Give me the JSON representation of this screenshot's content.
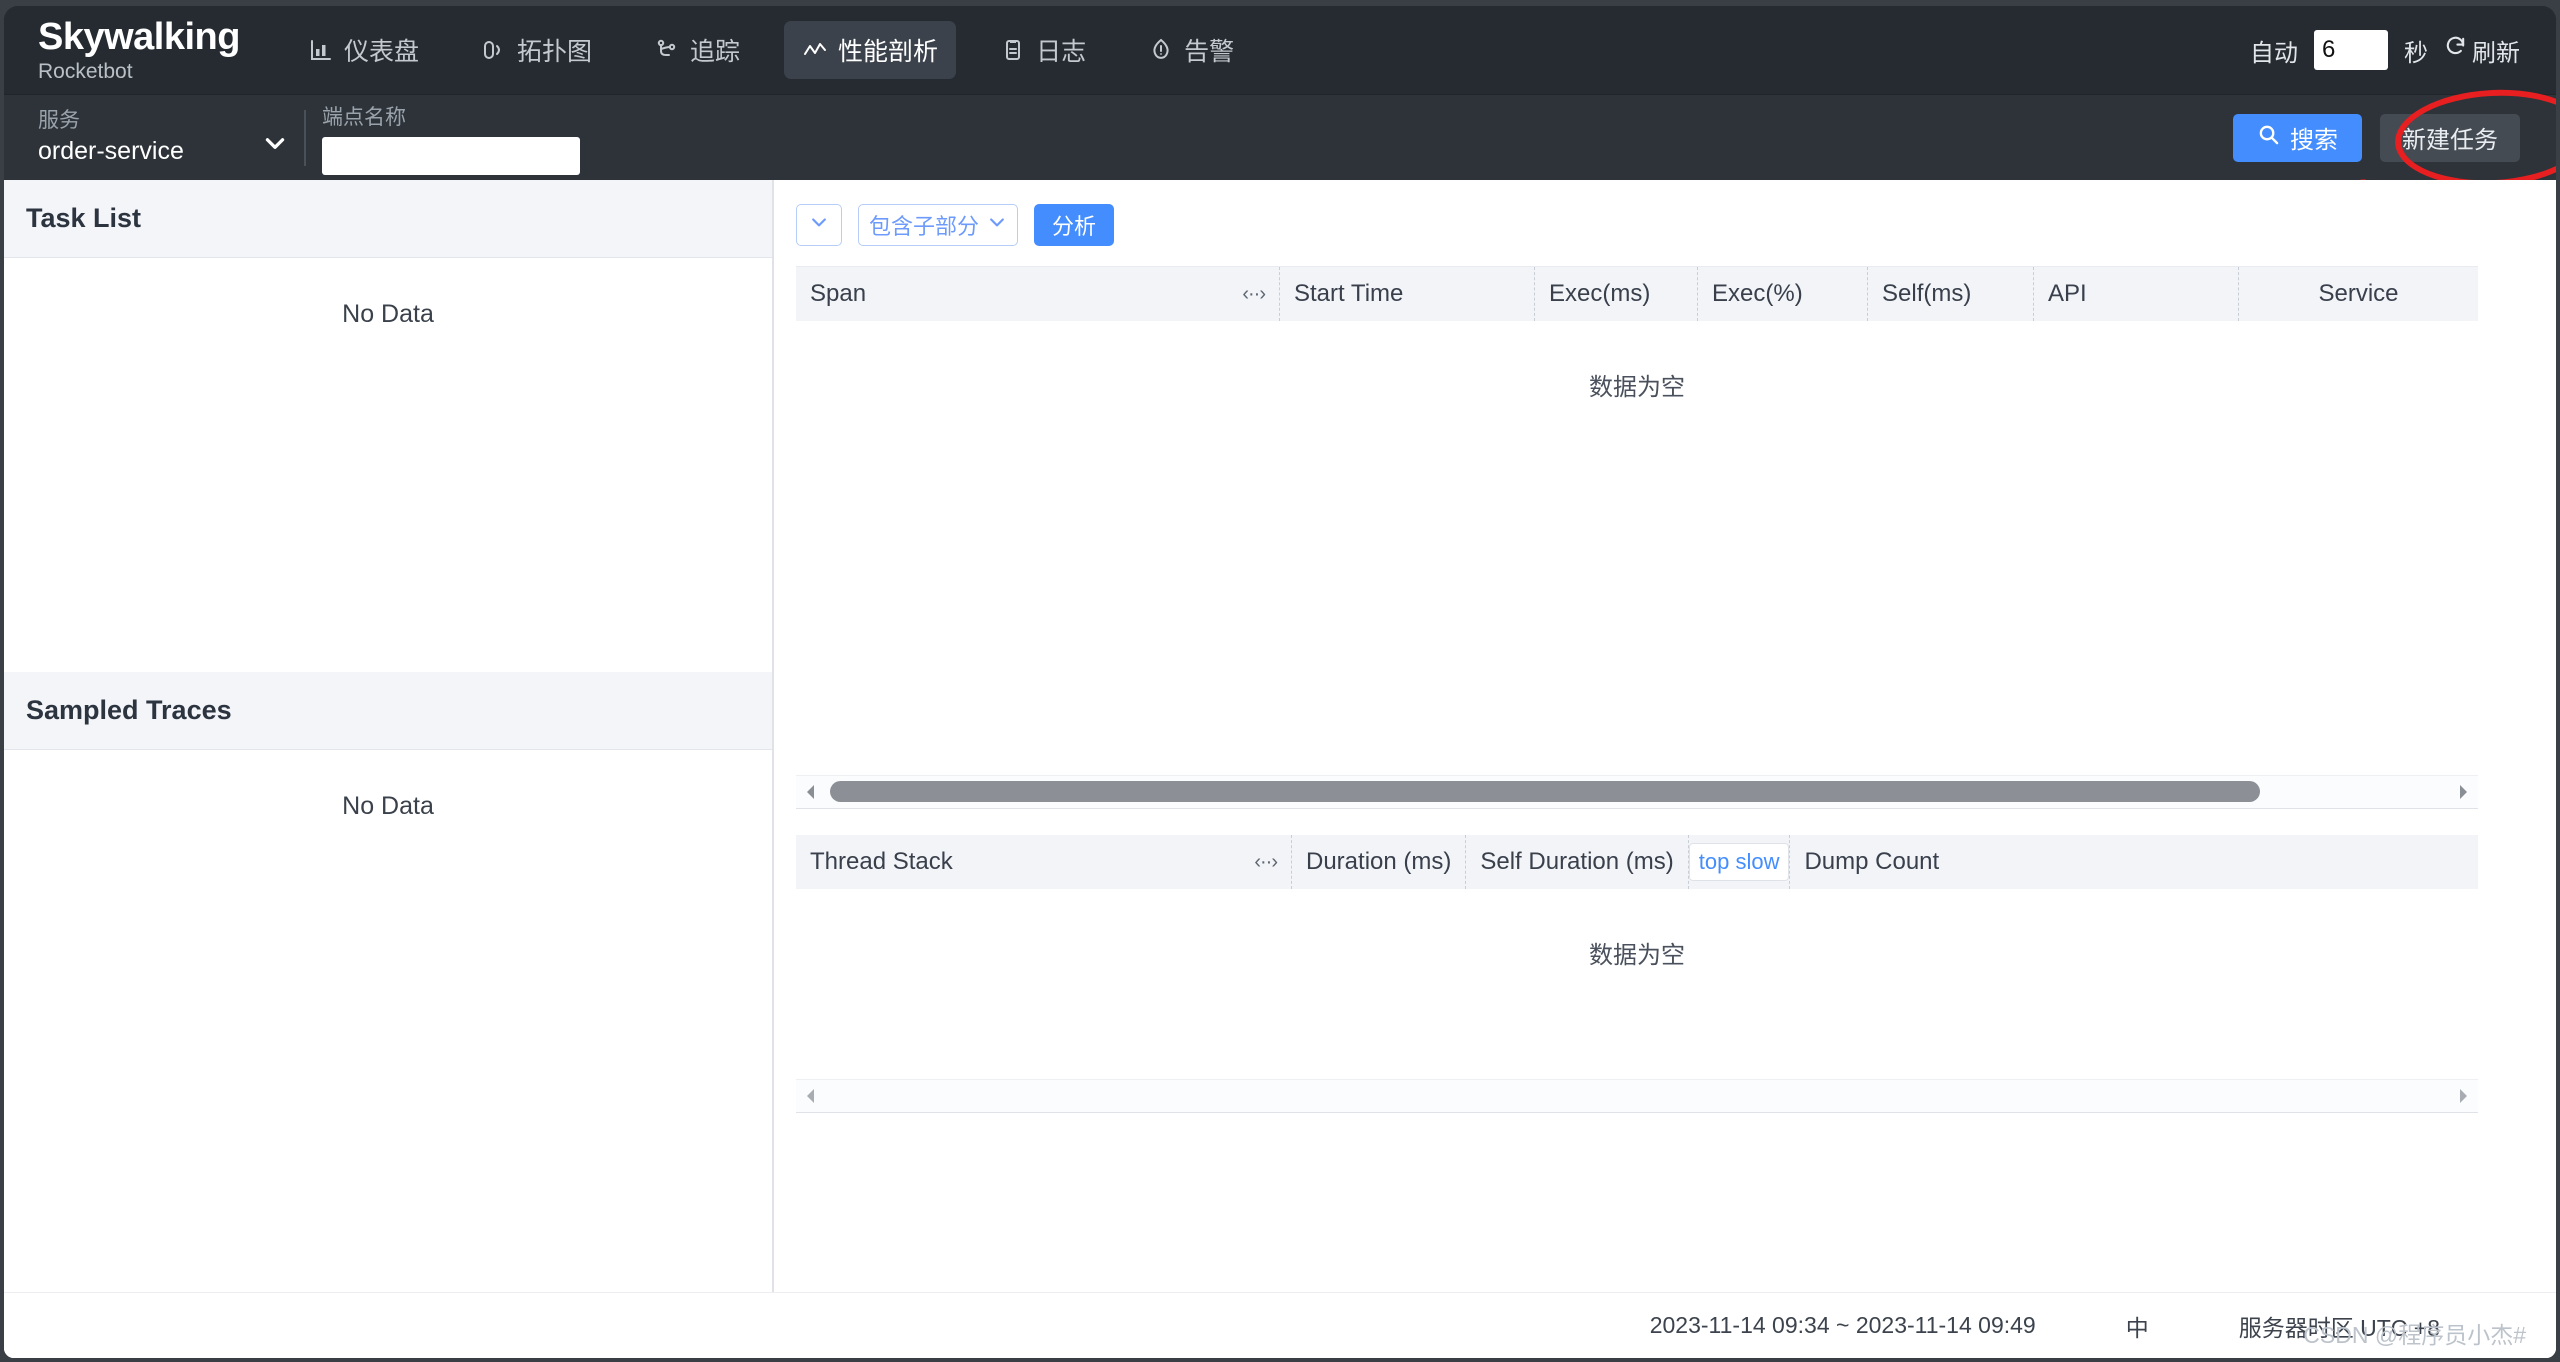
{
  "brand": {
    "name": "Skywalking",
    "sub": "Rocketbot"
  },
  "nav": {
    "items": [
      {
        "label": "仪表盘",
        "icon": "bar-chart-icon",
        "active": false
      },
      {
        "label": "拓扑图",
        "icon": "topology-icon",
        "active": false
      },
      {
        "label": "追踪",
        "icon": "trace-icon",
        "active": false
      },
      {
        "label": "性能剖析",
        "icon": "profile-wave-icon",
        "active": true
      },
      {
        "label": "日志",
        "icon": "log-icon",
        "active": false
      },
      {
        "label": "告警",
        "icon": "alarm-icon",
        "active": false
      }
    ],
    "auto_label": "自动",
    "auto_value": "6",
    "seconds_label": "秒",
    "refresh_label": "刷新"
  },
  "conditions": {
    "service_caption": "服务",
    "service_value": "order-service",
    "endpoint_caption": "端点名称",
    "endpoint_value": "",
    "endpoint_placeholder": "",
    "search_label": "搜索",
    "new_task_label": "新建任务"
  },
  "left": {
    "task_list_title": "Task List",
    "task_list_empty": "No Data",
    "sampled_traces_title": "Sampled Traces",
    "sampled_traces_empty": "No Data"
  },
  "controls": {
    "mini_select_value": "",
    "scope_select_value": "包含子部分",
    "analyze_label": "分析"
  },
  "span_table": {
    "columns": [
      "Span",
      "Start Time",
      "Exec(ms)",
      "Exec(%)",
      "Self(ms)",
      "API",
      "Service"
    ],
    "rows": [],
    "empty_text": "数据为空"
  },
  "thread_table": {
    "columns": [
      "Thread Stack",
      "Duration (ms)",
      "Self Duration (ms)",
      "Dump Count"
    ],
    "top_slow_label": "top slow",
    "rows": [],
    "empty_text": "数据为空"
  },
  "footer": {
    "time_range": "2023-11-14 09:34 ~ 2023-11-14 09:49",
    "language": "中",
    "timezone": "服务器时区 UTC +8",
    "watermark": "CSDN @程序员小杰#"
  },
  "colors": {
    "nav_bg": "#252b31",
    "cond_bg": "#2d3339",
    "accent": "#448dfe",
    "annotation_red": "#e81f20",
    "panel_head_bg": "#f3f5f9"
  }
}
